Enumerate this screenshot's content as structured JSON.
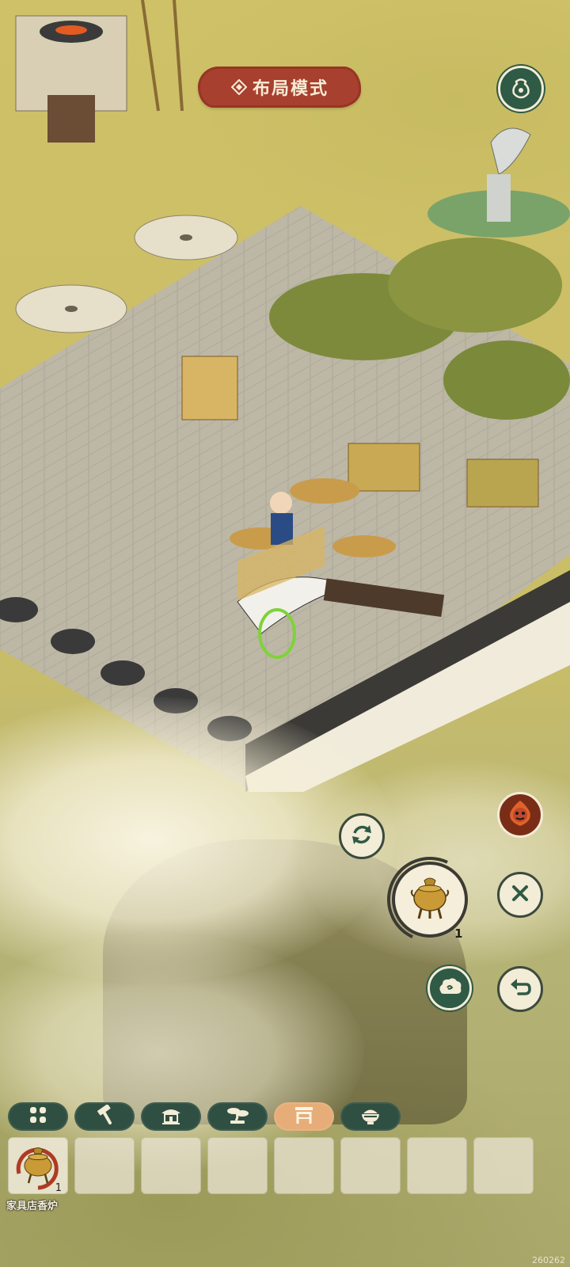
{
  "layout_mode": {
    "label": "布局模式",
    "icon": "diamond-ornament-icon",
    "color": "#a8402f"
  },
  "top_right_button": {
    "icon": "pouch-icon"
  },
  "actions": {
    "rotate": {
      "icon": "rotate-arrows-icon"
    },
    "fire_character": {
      "icon": "fire-demon-icon"
    },
    "cancel": {
      "icon": "close-icon"
    },
    "confirm_place": {
      "icon": "cloud-swirl-icon"
    },
    "undo": {
      "icon": "undo-arrow-icon"
    },
    "selected_furniture": {
      "icon": "censer-icon",
      "count": "1"
    }
  },
  "categories": [
    {
      "icon": "grid-four-icon",
      "active": false
    },
    {
      "icon": "hammer-icon",
      "active": false
    },
    {
      "icon": "pavilion-icon",
      "active": false
    },
    {
      "icon": "bonsai-icon",
      "active": false
    },
    {
      "icon": "table-icon",
      "active": true
    },
    {
      "icon": "rice-bowl-icon",
      "active": false
    }
  ],
  "inventory": {
    "slots": [
      {
        "icon": "censer-icon",
        "count": "1"
      },
      {},
      {},
      {},
      {},
      {},
      {},
      {}
    ],
    "first_item_label": "家具店香炉"
  },
  "corner_code": "260262",
  "colors": {
    "accent": "#a8402f",
    "button_dark": "#2f5a45",
    "tab_active": "#e6ad79",
    "tab_default": "#2f4f42"
  }
}
